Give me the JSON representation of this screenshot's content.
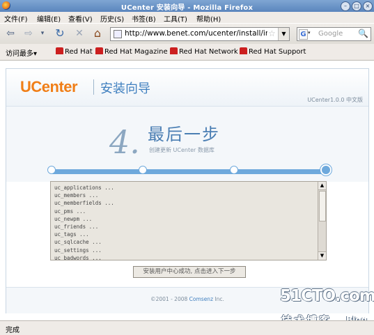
{
  "window": {
    "title": "UCenter 安装向导 - Mozilla Firefox",
    "min": "–",
    "max": "□",
    "close": "×"
  },
  "menu": [
    "文件(F)",
    "编辑(E)",
    "查看(V)",
    "历史(S)",
    "书签(B)",
    "工具(T)",
    "帮助(H)"
  ],
  "nav": {
    "back": "⇦",
    "forward": "⇨",
    "history_dropdown": "▾",
    "reload": "↻",
    "stop": "✕",
    "home": "⌂",
    "url": "http://www.benet.com/ucenter/install/inde",
    "url_star": "☆",
    "url_dropdown": "▼",
    "search_engine": "G",
    "search_engine_dropdown": "▾",
    "search_placeholder": "Google",
    "search_icon": "🔍"
  },
  "bookmarks": {
    "most_visited": "访问最多▾",
    "items": [
      "Red Hat",
      "Red Hat Magazine",
      "Red Hat Network",
      "Red Hat Support"
    ]
  },
  "installer": {
    "logo": "UCenter",
    "wizard_title": "安装向导",
    "version": "UCenter1.0.0 中文版",
    "step_number": "4.",
    "step_title": "最后一步",
    "step_subtitle": "创建更新 UCenter 数据库",
    "progress_steps": 4,
    "current_step": 4,
    "log_lines": [
      "uc_applications ...",
      "uc_members ...",
      "uc_memberfields ...",
      "uc_pms ...",
      "uc_newpm ...",
      "uc_friends ...",
      "uc_tags ...",
      "uc_sqlcache ...",
      "uc_settings ...",
      "uc_badwords ..."
    ],
    "next_button": "安装用户中心成功, 点击进入下一步",
    "footer_prefix": "©2001 - 2008",
    "footer_company": "Comsenz",
    "footer_suffix": "Inc."
  },
  "watermark": {
    "line1": "51CTO.com",
    "line2": "技术博客",
    "line3": "Blog"
  },
  "status": "完成",
  "colors": {
    "accent_orange": "#f07e17",
    "accent_blue": "#3f7fbf",
    "progress": "#6ea9dc"
  }
}
